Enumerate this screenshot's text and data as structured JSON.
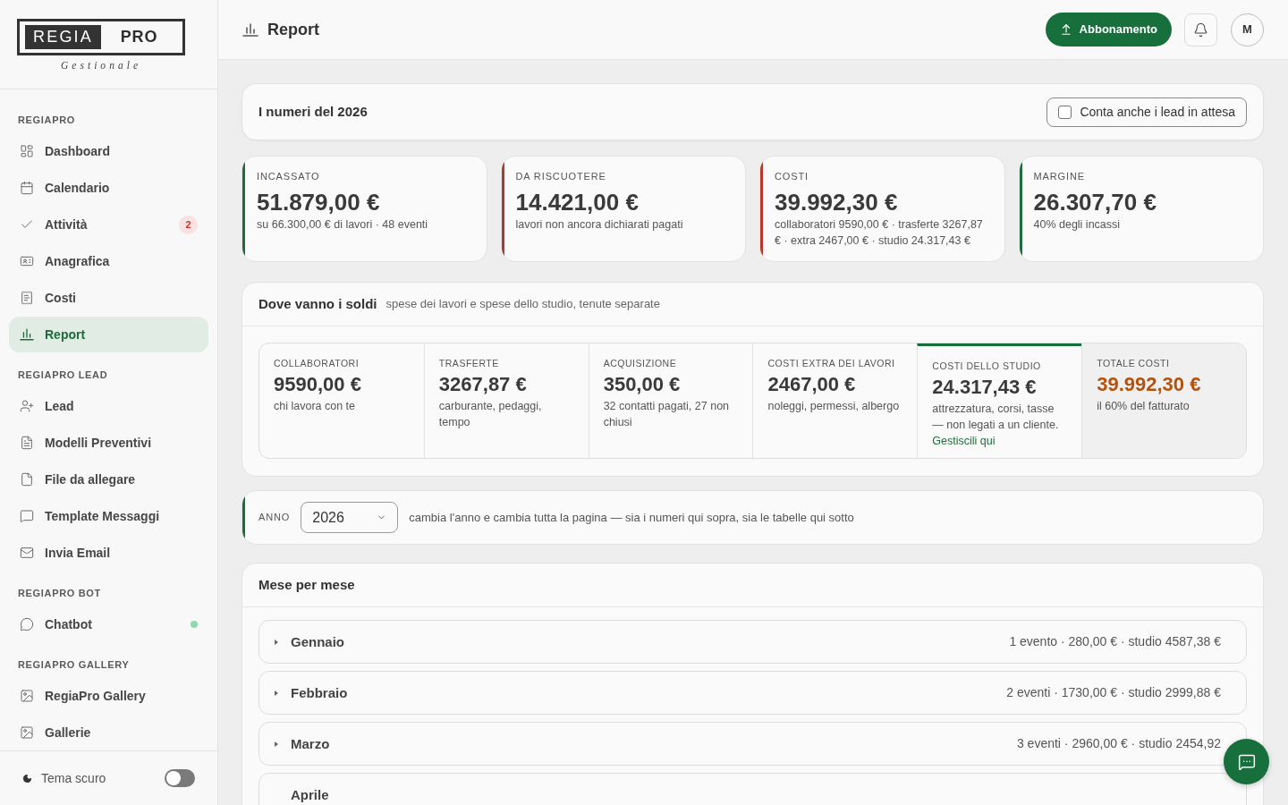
{
  "sidebar": {
    "logo": {
      "left": "REGIA",
      "right": "PRO",
      "tagline": "Gestionale"
    },
    "sections": [
      {
        "title": "REGIAPRO",
        "items": [
          {
            "label": "Dashboard",
            "selected": false
          },
          {
            "label": "Calendario",
            "selected": false
          },
          {
            "label": "Attività",
            "selected": false,
            "badge": "2"
          },
          {
            "label": "Anagrafica",
            "selected": false
          },
          {
            "label": "Costi",
            "selected": false
          },
          {
            "label": "Report",
            "selected": true
          }
        ]
      },
      {
        "title": "REGIAPRO LEAD",
        "items": [
          {
            "label": "Lead",
            "selected": false
          },
          {
            "label": "Modelli Preventivi",
            "selected": false
          },
          {
            "label": "File da allegare",
            "selected": false
          },
          {
            "label": "Template Messaggi",
            "selected": false
          },
          {
            "label": "Invia Email",
            "selected": false
          }
        ]
      },
      {
        "title": "REGIAPRO BOT",
        "items": [
          {
            "label": "Chatbot",
            "selected": false,
            "online": true
          }
        ]
      },
      {
        "title": "REGIAPRO GALLERY",
        "items": [
          {
            "label": "RegiaPro Gallery",
            "selected": false
          },
          {
            "label": "Gallerie",
            "selected": false
          }
        ]
      }
    ],
    "theme_toggle": {
      "label": "Tema scuro",
      "on": false
    }
  },
  "header": {
    "title": "Report",
    "subscription_button": "Abbonamento",
    "avatar": "M"
  },
  "overview": {
    "title": "I numeri del 2026",
    "checkbox": {
      "label": "Conta anche i lead in attesa",
      "checked": false
    }
  },
  "stats": [
    {
      "label": "INCASSATO",
      "value": "51.879,00 €",
      "note": "su 66.300,00 € di lavori · 48 eventi",
      "color": "#1f6b3b"
    },
    {
      "label": "DA RISCUOTERE",
      "value": "14.421,00 €",
      "note": "lavori non ancora dichiarati pagati",
      "color": "#b3372b"
    },
    {
      "label": "COSTI",
      "value": "39.992,30 €",
      "note": "collaboratori 9590,00 € · trasferte 3267,87 € · extra 2467,00 € · studio 24.317,43 €",
      "color": "#b3372b"
    },
    {
      "label": "MARGINE",
      "value": "26.307,70 €",
      "note": "40% degli incassi",
      "color": "#1f6b3b"
    }
  ],
  "breakdown": {
    "title": "Dove vanno i soldi",
    "subtitle": "spese dei lavori e spese dello studio, tenute separate",
    "items": [
      {
        "kind": "cost",
        "label": "COLLABORATORI",
        "value": "9590,00 €",
        "note": "chi lavora con te"
      },
      {
        "kind": "cost",
        "label": "TRASFERTE",
        "value": "3267,87 €",
        "note": "carburante, pedaggi, tempo"
      },
      {
        "kind": "cost",
        "label": "ACQUISIZIONE",
        "value": "350,00 €",
        "note": "32 contatti pagati, 27 non chiusi"
      },
      {
        "kind": "cost",
        "label": "COSTI EXTRA DEI LAVORI",
        "value": "2467,00 €",
        "note": "noleggi, permessi, albergo"
      },
      {
        "kind": "studio",
        "label": "COSTI DELLO STUDIO",
        "value": "24.317,43 €",
        "note": "attrezzatura, corsi, tasse — non legati a un cliente.",
        "link": "Gestiscili qui"
      },
      {
        "kind": "total",
        "label": "TOTALE COSTI",
        "value": "39.992,30 €",
        "note": "il 60% del fatturato"
      }
    ]
  },
  "year_filter": {
    "label": "ANNO",
    "value": "2026",
    "hint": "cambia l'anno e cambia tutta la pagina — sia i numeri qui sopra, sia le tabelle qui sotto"
  },
  "monthly": {
    "title": "Mese per mese",
    "months": [
      {
        "name": "Gennaio",
        "summary": "1 evento · 280,00 € · studio 4587,38 €",
        "expanded": false
      },
      {
        "name": "Febbraio",
        "summary": "2 eventi · 1730,00 € · studio 2999,88 €",
        "expanded": false
      },
      {
        "name": "Marzo",
        "summary": "3 eventi · 2960,00 € · studio 2454,92",
        "expanded": false
      },
      {
        "name": "Aprile"
      }
    ]
  }
}
